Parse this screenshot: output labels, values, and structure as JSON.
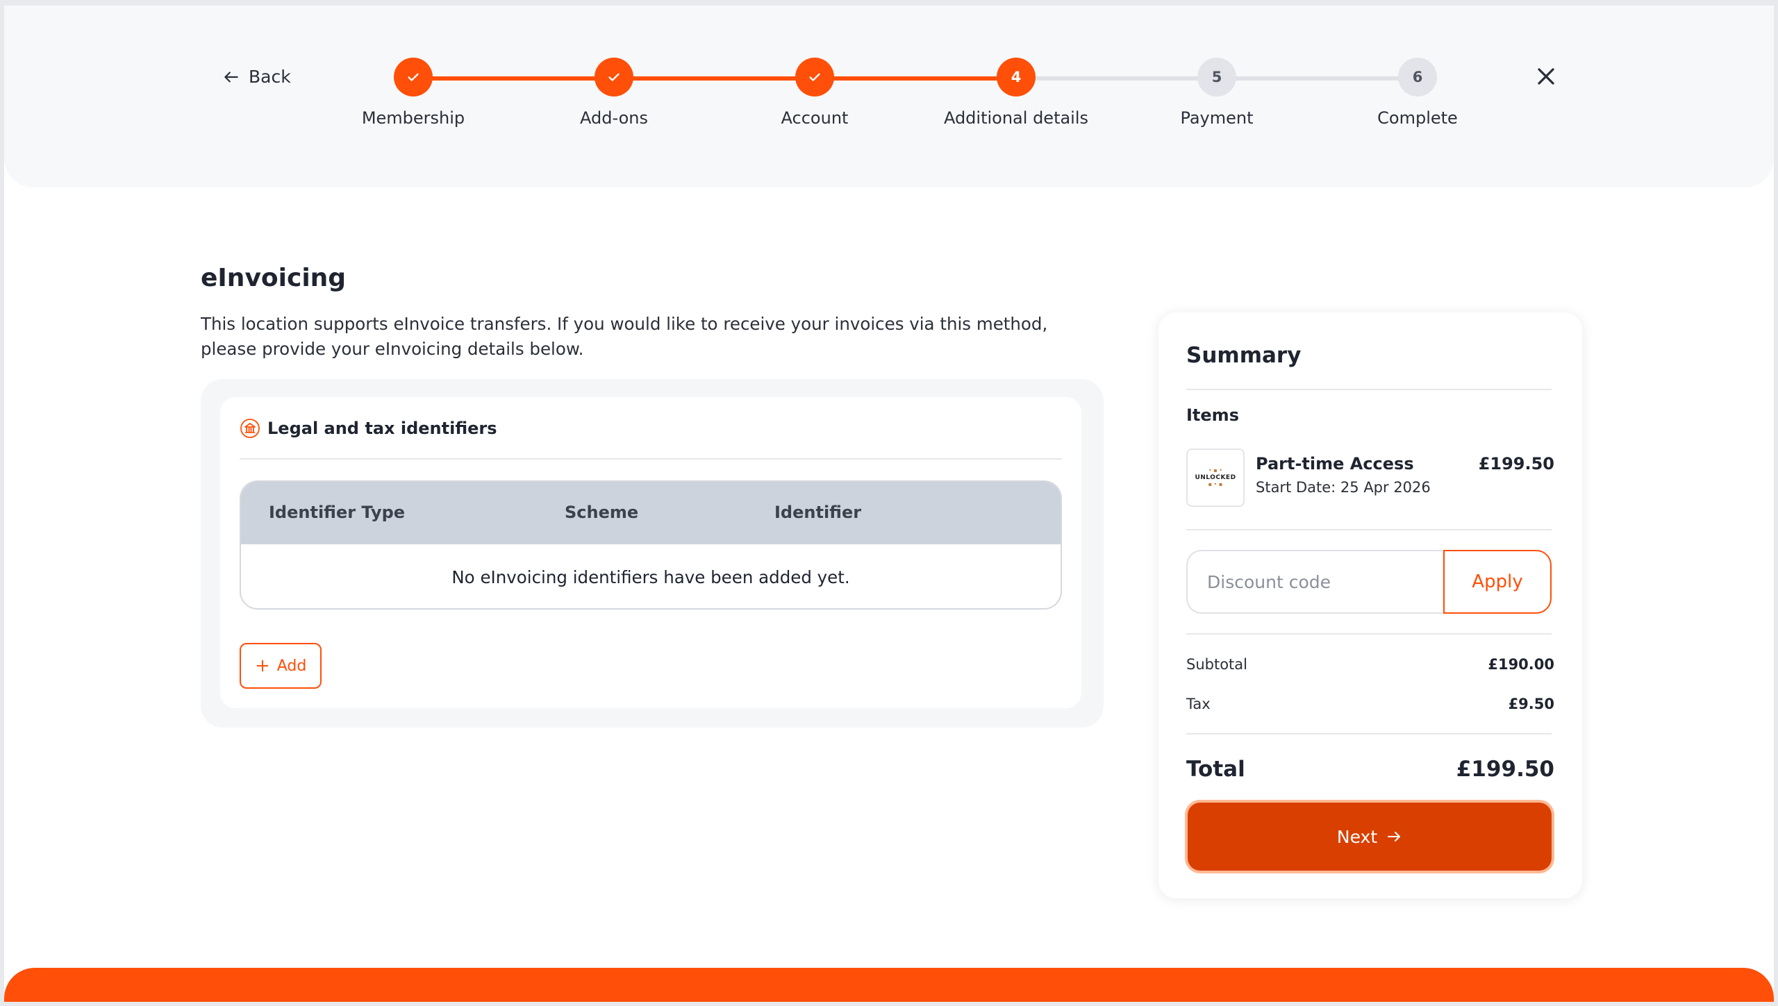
{
  "nav": {
    "back_label": "Back",
    "close_icon": "close-icon"
  },
  "stepper": {
    "steps": [
      {
        "label": "Membership",
        "number": "1",
        "state": "done"
      },
      {
        "label": "Add-ons",
        "number": "2",
        "state": "done"
      },
      {
        "label": "Account",
        "number": "3",
        "state": "done"
      },
      {
        "label": "Additional details",
        "number": "4",
        "state": "active"
      },
      {
        "label": "Payment",
        "number": "5",
        "state": "todo"
      },
      {
        "label": "Complete",
        "number": "6",
        "state": "todo"
      }
    ]
  },
  "einvoicing": {
    "title": "eInvoicing",
    "description": "This location supports eInvoice transfers. If you would like to receive your invoices via this method, please provide your eInvoicing details below.",
    "section_title": "Legal and tax identifiers",
    "table": {
      "columns": [
        "Identifier Type",
        "Scheme",
        "Identifier"
      ],
      "empty_message": "No eInvoicing identifiers have been added yet."
    },
    "add_label": "Add"
  },
  "summary": {
    "title": "Summary",
    "items_label": "Items",
    "items": [
      {
        "name": "Part-time Access",
        "start_date": "Start Date: 25 Apr 2026",
        "price": "£199.50",
        "thumb_text": "UNLOCKED"
      }
    ],
    "discount_placeholder": "Discount code",
    "apply_label": "Apply",
    "subtotal_label": "Subtotal",
    "subtotal_value": "£190.00",
    "tax_label": "Tax",
    "tax_value": "£9.50",
    "total_label": "Total",
    "total_value": "£199.50",
    "next_label": "Next"
  },
  "colors": {
    "accent": "#ff4f08",
    "next_button": "#d94000",
    "table_header": "#cdd3dc"
  }
}
